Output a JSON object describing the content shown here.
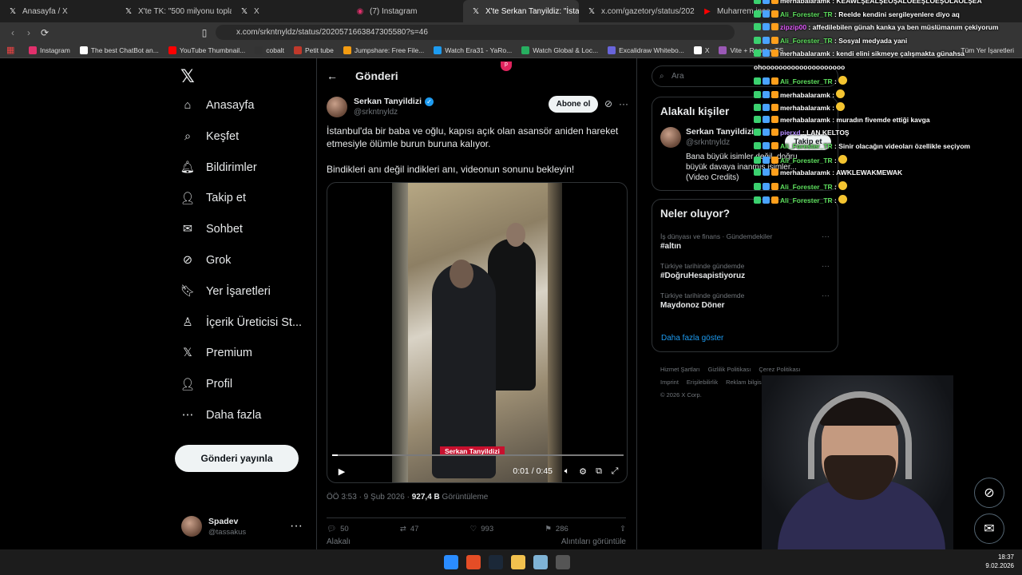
{
  "browser": {
    "tabs": [
      {
        "title": "Anasayfa / X",
        "icon": "x-logo-icon"
      },
      {
        "title": "X'te TK: \"500 milyonu topladı ve",
        "icon": "x-logo-icon"
      },
      {
        "title": "X",
        "icon": "x-logo-icon"
      },
      {
        "title": "(7) Instagram",
        "icon": "instagram-icon"
      },
      {
        "title": "X'te Serkan Tanyildiz: \"İsta",
        "icon": "x-logo-icon"
      },
      {
        "title": "x.com/gazetory/status/202028",
        "icon": "x-logo-icon"
      },
      {
        "title": "Muharrem ince",
        "icon": "youtube-icon"
      }
    ],
    "url": "x.com/srkntnyldz/status/2020571663847305580?s=46",
    "bookmarks": [
      "Instagram",
      "The best ChatBot an...",
      "YouTube Thumbnail...",
      "cobalt",
      "Petit tube",
      "Jumpshare: Free File...",
      "Watch Era31 - YaRo...",
      "Watch Global & Loc...",
      "Excalidraw Whitebo...",
      "X",
      "Vite + React + TS"
    ],
    "all_bookmarks": "Tüm Yer İşaretleri"
  },
  "sidebar": {
    "items": [
      {
        "label": "Anasayfa",
        "icon": "home-icon"
      },
      {
        "label": "Keşfet",
        "icon": "search-icon"
      },
      {
        "label": "Bildirimler",
        "icon": "bell-icon"
      },
      {
        "label": "Takip et",
        "icon": "follow-icon"
      },
      {
        "label": "Sohbet",
        "icon": "mail-icon"
      },
      {
        "label": "Grok",
        "icon": "grok-icon"
      },
      {
        "label": "Yer İşaretleri",
        "icon": "bookmark-icon"
      },
      {
        "label": "İçerik Üreticisi St...",
        "icon": "creator-icon"
      },
      {
        "label": "Premium",
        "icon": "x-logo-icon"
      },
      {
        "label": "Profil",
        "icon": "profile-icon"
      },
      {
        "label": "Daha fazla",
        "icon": "more-icon"
      }
    ],
    "post_button": "Gönderi yayınla",
    "account": {
      "name": "Spadev",
      "handle": "@tassakus"
    }
  },
  "post": {
    "header": "Gönderi",
    "author_name": "Serkan Tanyildizi",
    "author_handle": "@srkntnyldz",
    "follow_label": "Abone ol",
    "text_1": "İstanbul'da bir baba ve oğlu, kapısı açık olan asansör aniden hareket etmesiyle ölümle burun buruna kalıyor.",
    "text_2": "Bindikleri anı değil indikleri anı, videonun sonunu bekleyin!",
    "video_tag": "Serkan Tanyildizi",
    "video_time": "0:01 / 0:45",
    "video_progress": 0.02,
    "timestamp": "ÖÖ 3:53 · 9 Şub 2026 · ",
    "views": "927,4 B",
    "views_label": " Görüntüleme",
    "replies": "50",
    "reposts": "47",
    "likes": "993",
    "bookmarks": "286",
    "related": "Alakalı",
    "quotes": "Alıntıları görüntüle"
  },
  "right": {
    "search_placeholder": "Ara",
    "people_title": "Alakalı kişiler",
    "person_name": "Serkan Tanyildizi",
    "person_handle": "@srkntnyldz",
    "person_follow": "Takip et",
    "person_bio": "Bana büyük isimler değil, doğru büyük davaya inanmış isimler... (Video Credits)",
    "trends_title": "Neler oluyor?",
    "trends": [
      {
        "meta": "İş dünyası ve finans · Gündemdekiler",
        "name": "#altın"
      },
      {
        "meta": "Türkiye tarihinde gündemde",
        "name": "#DoğruHesapistiyoruz"
      },
      {
        "meta": "Türkiye tarihinde gündemde",
        "name": "Maydonoz Döner"
      }
    ],
    "show_more": "Daha fazla göster",
    "footer": [
      "Hizmet Şartları",
      "Gizlilik Politikası",
      "Çerez Politikası",
      "Imprint",
      "Erişilebilirlik",
      "Reklam bilgisi",
      "Daha fazla ...",
      "© 2026 X Corp."
    ]
  },
  "chat": [
    {
      "user": "merhabalaramk",
      "msg": "KEAWLŞEALŞEOŞALOEEŞLOEŞOLAOLŞEA"
    },
    {
      "user": "Ali_Forester_TR",
      "msg": "Reelde kendini sergileyenlere diyo aq"
    },
    {
      "user": "zipzip00",
      "msg": "affedilebilen günah kanka ya ben müslümanım çekiyorum"
    },
    {
      "user": "Ali_Forester_TR",
      "msg": "Sosyal medyada yani"
    },
    {
      "user": "merhabalaramk",
      "msg": "kendi elini sikmeye çalışmakta günahsa"
    },
    {
      "user": "",
      "msg": "ohoooooooooooooooooooo"
    },
    {
      "user": "Ali_Forester_TR",
      "msg": ""
    },
    {
      "user": "merhabalaramk",
      "msg": ""
    },
    {
      "user": "merhabalaramk",
      "msg": ""
    },
    {
      "user": "merhabalaramk",
      "msg": "muradın fivemde ettiği kavga"
    },
    {
      "user": "pierxd",
      "msg": "LAN KELTOŞ"
    },
    {
      "user": "Ali_Forester_TR",
      "msg": "Sinir olacağın videoları özellikle seçiyom"
    },
    {
      "user": "Ali_Forester_TR",
      "msg": ""
    },
    {
      "user": "merhabalaramk",
      "msg": "AWKLEWAKMEWAK"
    },
    {
      "user": "Ali_Forester_TR",
      "msg": ""
    },
    {
      "user": "Ali_Forester_TR",
      "msg": ""
    }
  ],
  "clock": {
    "time": "18:37",
    "date": "9.02.2026"
  }
}
